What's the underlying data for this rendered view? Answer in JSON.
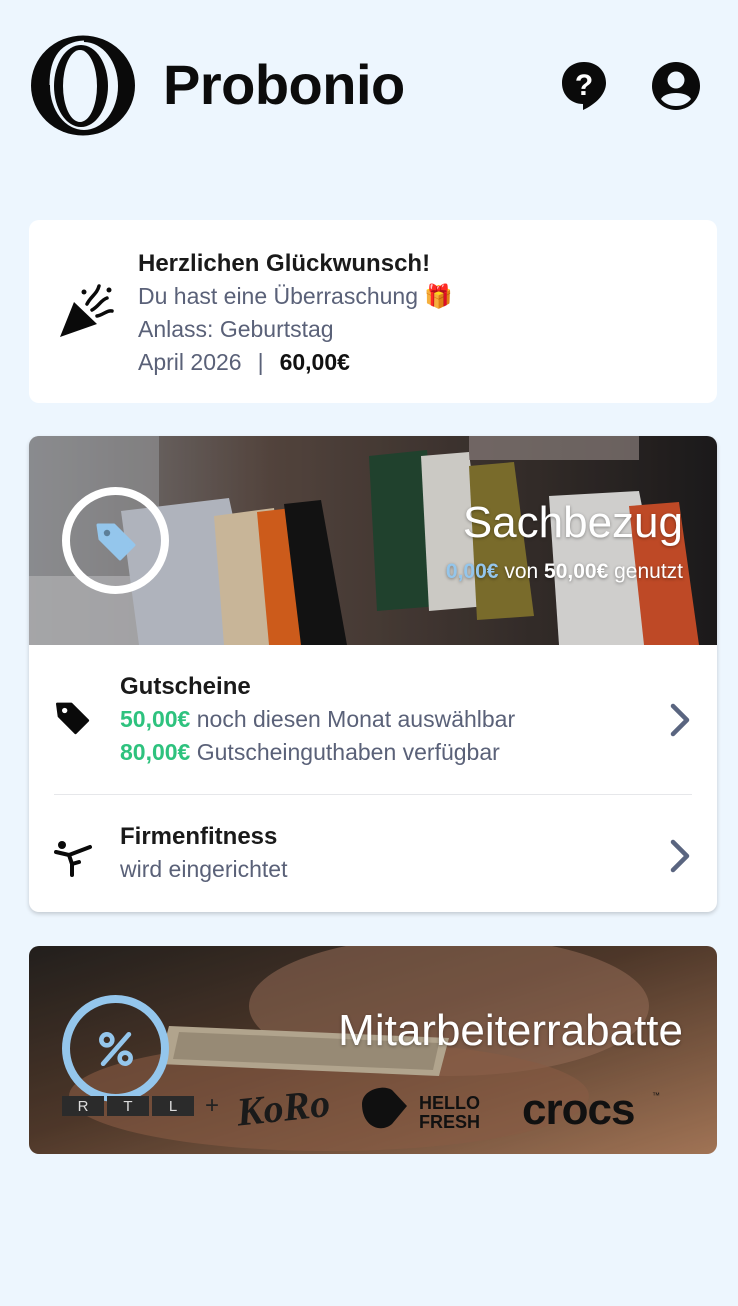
{
  "header": {
    "brand": "Probonio",
    "icons": [
      "help-icon",
      "account-icon"
    ]
  },
  "surprise": {
    "icon": "party-popper-icon",
    "title": "Herzlichen Glückwunsch!",
    "subtitle": "Du hast eine Überraschung 🎁",
    "occasion": "Anlass: Geburtstag",
    "date": "April 2026",
    "separator": "|",
    "amount": "60,00€"
  },
  "sachbezug": {
    "title": "Sachbezug",
    "icon": "tag-icon",
    "used": "0,00€",
    "of_label": "von",
    "total": "50,00€",
    "used_label": "genutzt",
    "rows": [
      {
        "icon": "tag-icon",
        "title": "Gutscheine",
        "line1_amount": "50,00€",
        "line1_text": "noch diesen Monat auswählbar",
        "line2_amount": "80,00€",
        "line2_text": "Gutscheinguthaben verfügbar"
      },
      {
        "icon": "karate-kick-icon",
        "title": "Firmenfitness",
        "status": "wird eingerichtet"
      }
    ]
  },
  "rabatte": {
    "title": "Mitarbeiterrabatte",
    "icon": "percent-icon",
    "partner_logos": [
      "R T L +",
      "KoRo",
      "HELLO FRESH",
      "crocs™"
    ]
  },
  "colors": {
    "background": "#edf6fe",
    "accent_blue": "#94c6ec",
    "green": "#2ec27e",
    "muted_text": "#5a6178",
    "chevron": "#5a6580"
  }
}
